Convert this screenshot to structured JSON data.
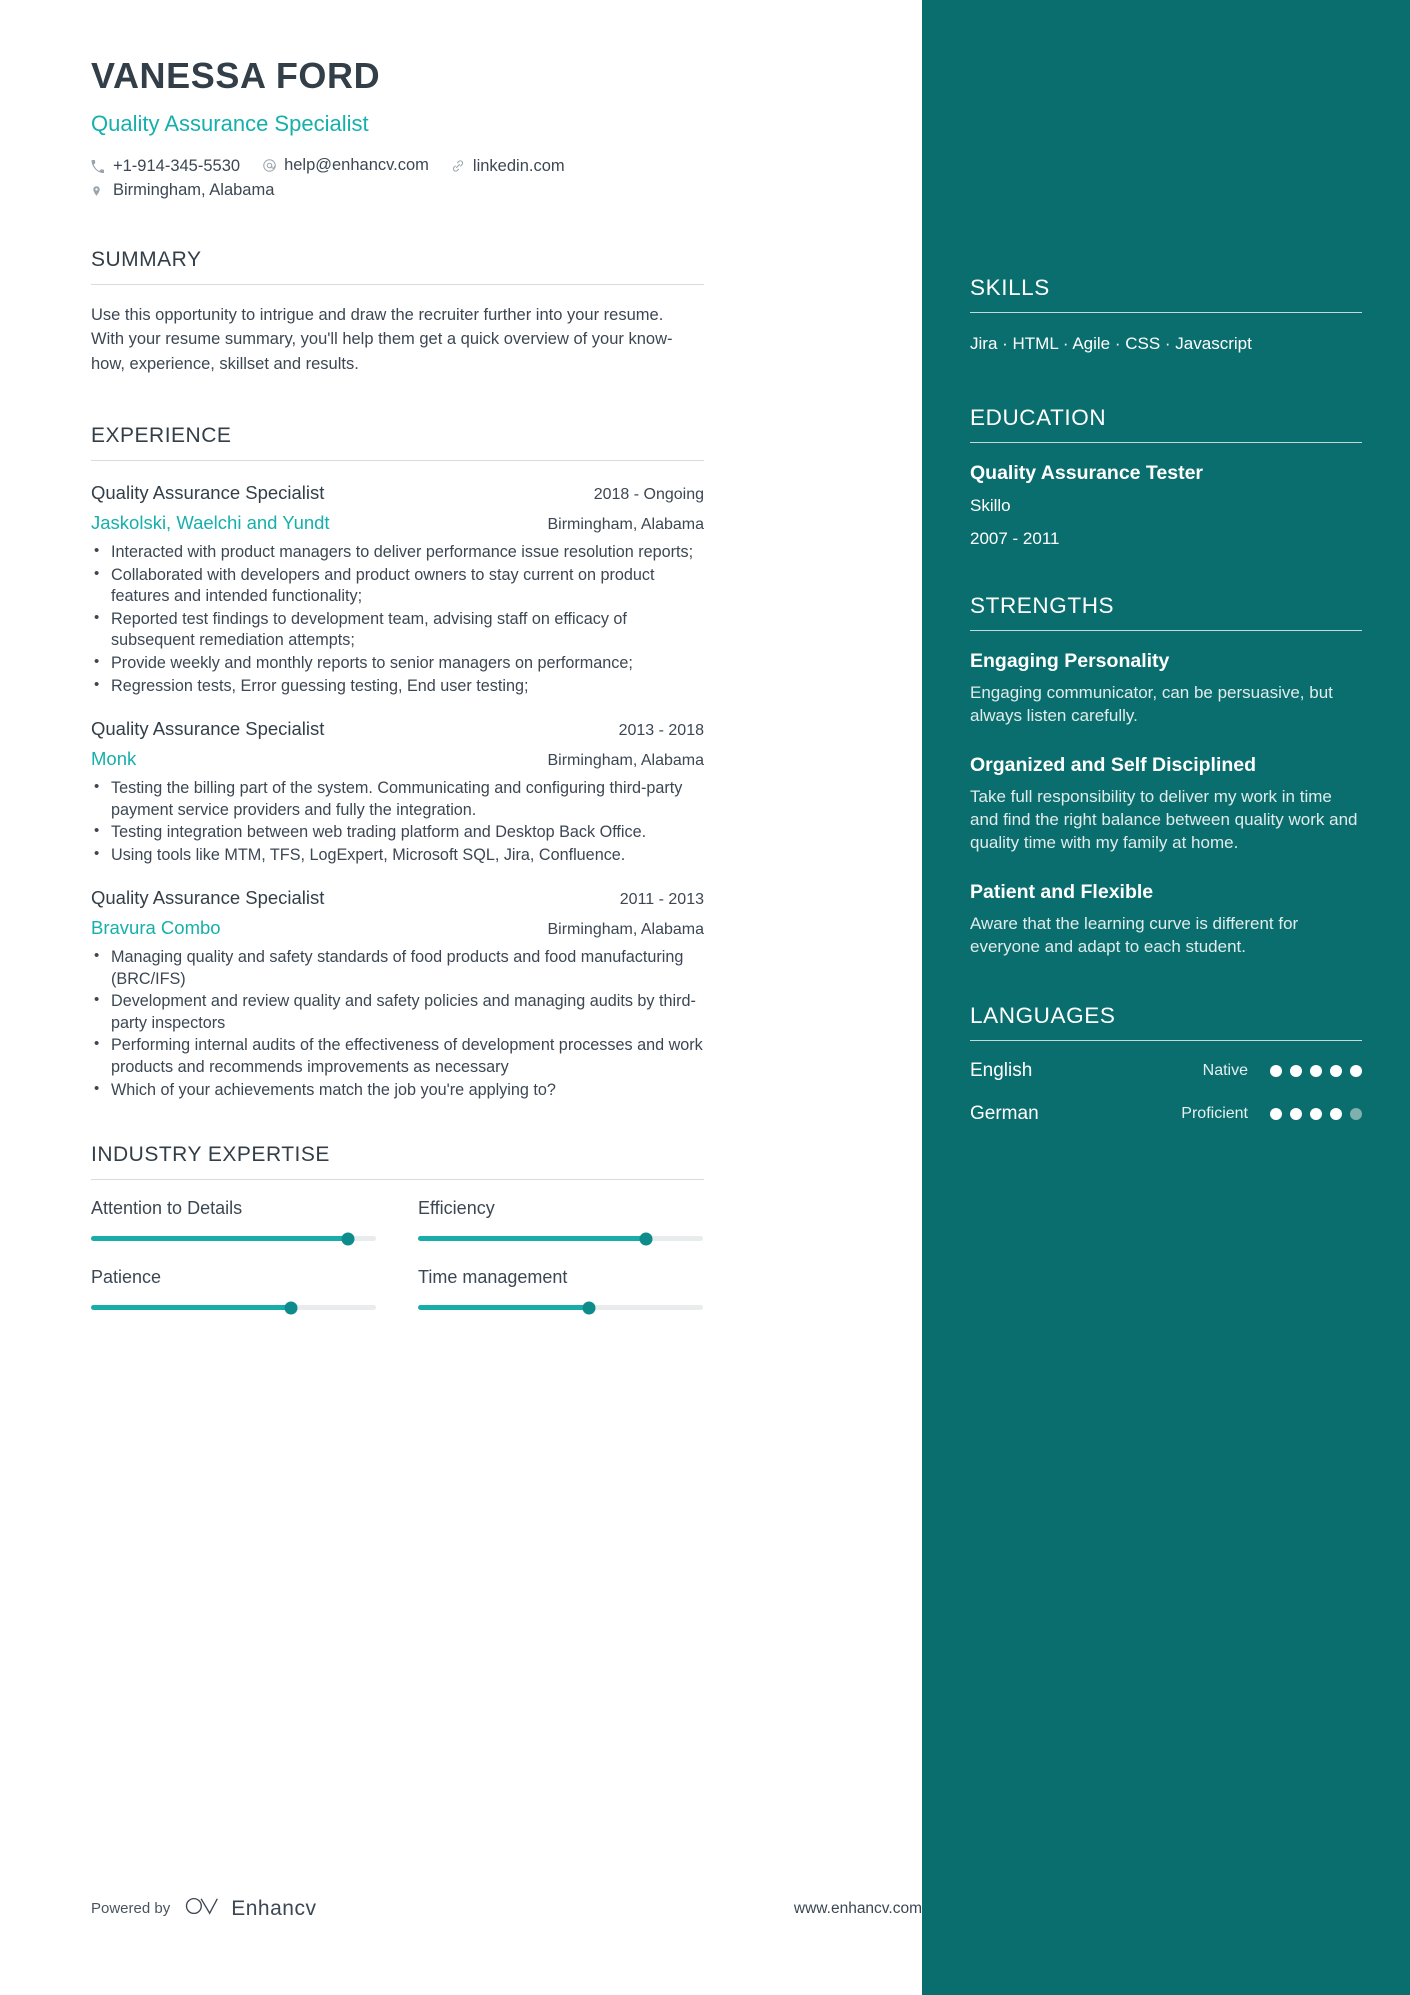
{
  "header": {
    "name": "VANESSA FORD",
    "role": "Quality Assurance Specialist",
    "contacts": [
      {
        "icon": "phone-icon",
        "text": "+1-914-345-5530"
      },
      {
        "icon": "email-icon",
        "text": "help@enhancv.com"
      },
      {
        "icon": "link-icon",
        "text": "linkedin.com"
      },
      {
        "icon": "location-icon",
        "text": "Birmingham, Alabama"
      }
    ]
  },
  "summary": {
    "title": "SUMMARY",
    "text": "Use this opportunity to intrigue and draw the recruiter further into your resume. With your resume summary, you'll help them get a quick overview of your know-how, experience, skillset and results."
  },
  "experience": {
    "title": "EXPERIENCE",
    "jobs": [
      {
        "title": "Quality Assurance Specialist",
        "dates": "2018 - Ongoing",
        "company": "Jaskolski, Waelchi and Yundt",
        "location": "Birmingham, Alabama",
        "bullets": [
          "Interacted with product managers to deliver performance issue resolution reports;",
          "Collaborated with developers and product owners to stay current on product features and intended functionality;",
          "Reported test findings to development team, advising staff on efficacy of subsequent remediation attempts;",
          "Provide weekly and monthly reports to senior managers on performance;",
          "Regression tests, Error guessing testing, End user testing;"
        ]
      },
      {
        "title": "Quality Assurance Specialist",
        "dates": "2013 - 2018",
        "company": "Monk",
        "location": "Birmingham, Alabama",
        "bullets": [
          "Testing the billing part of the system. Communicating and configuring third-party payment service providers and fully the integration.",
          "Testing integration between web trading platform and Desktop Back Office.",
          " Using tools like MTM, TFS, LogExpert, Microsoft SQL, Jira, Confluence."
        ]
      },
      {
        "title": "Quality Assurance Specialist",
        "dates": "2011 - 2013",
        "company": "Bravura Combo",
        "location": "Birmingham, Alabama",
        "bullets": [
          "Managing quality and safety standards of food products and food manufacturing (BRC/IFS)",
          "Development and review quality and safety policies and managing audits by third-party inspectors",
          "Performing internal audits of the effectiveness of development processes and work products and recommends improvements as necessary",
          "Which of your achievements match the job you're applying to?"
        ]
      }
    ]
  },
  "industry_expertise": {
    "title": "INDUSTRY EXPERTISE",
    "items": [
      {
        "label": "Attention to Details",
        "value": 90
      },
      {
        "label": "Efficiency",
        "value": 80
      },
      {
        "label": "Patience",
        "value": 70
      },
      {
        "label": "Time management",
        "value": 60
      }
    ]
  },
  "sidebar": {
    "skills": {
      "title": "SKILLS",
      "items": [
        "Jira",
        "HTML",
        "Agile",
        "CSS",
        "Javascript"
      ],
      "separator": " · "
    },
    "education": {
      "title": "EDUCATION",
      "entries": [
        {
          "degree": "Quality Assurance Tester",
          "school": "Skillo",
          "dates": "2007 - 2011"
        }
      ]
    },
    "strengths": {
      "title": "STRENGTHS",
      "items": [
        {
          "name": "Engaging Personality",
          "description": "Engaging communicator, can be persuasive, but always listen carefully."
        },
        {
          "name": "Organized and Self Disciplined",
          "description": "Take full responsibility to deliver my work in time and find the right balance between quality work and quality time with my family at home."
        },
        {
          "name": "Patient and Flexible",
          "description": "Aware that the learning curve is different for everyone and adapt to each student."
        }
      ]
    },
    "languages": {
      "title": "LANGUAGES",
      "items": [
        {
          "name": "English",
          "level": "Native",
          "filled": 5,
          "total": 5
        },
        {
          "name": "German",
          "level": "Proficient",
          "filled": 4,
          "total": 5
        }
      ]
    }
  },
  "footer": {
    "powered_by": "Powered by",
    "brand": "Enhancv",
    "website": "www.enhancv.com"
  },
  "colors": {
    "accent_teal": "#16b0ac",
    "sidebar_bg": "#0b6e6e",
    "text_dark": "#333f48",
    "slider_fill": "#19ada9"
  }
}
